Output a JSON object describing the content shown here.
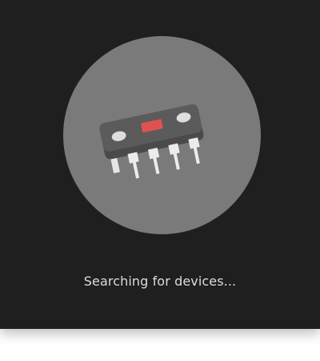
{
  "status": {
    "message": "Searching for devices..."
  },
  "graphic": {
    "icon": "chip-icon",
    "circle_color": "#7a7a7a",
    "led_color": "#e05252"
  },
  "colors": {
    "background": "#1f1f1f",
    "text": "#dcdcdc"
  }
}
